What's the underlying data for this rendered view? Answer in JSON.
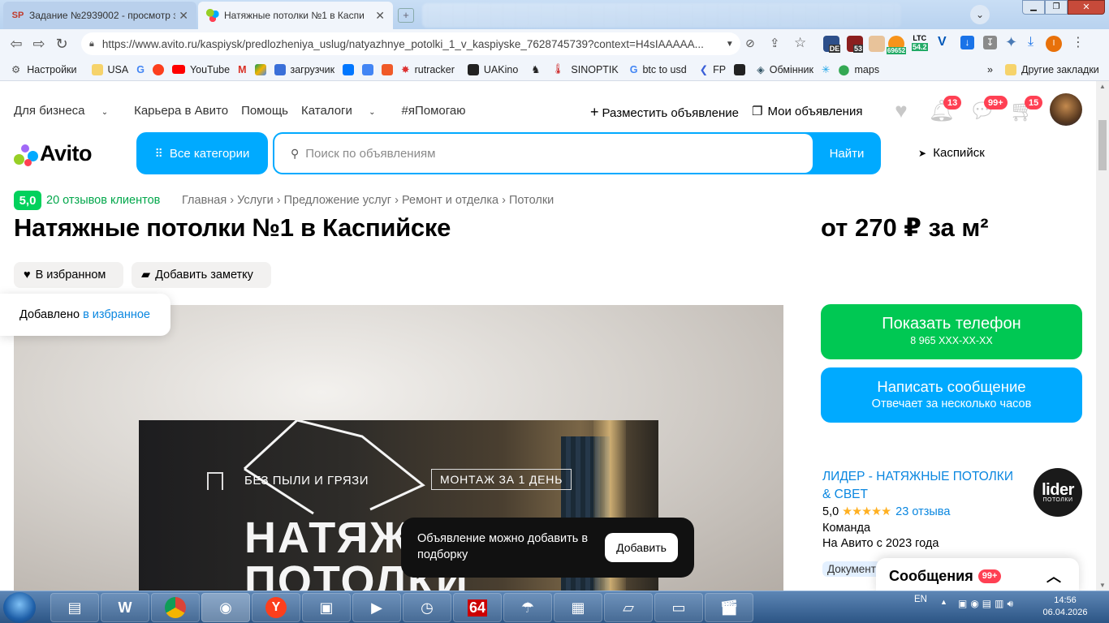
{
  "browser": {
    "tabs": [
      {
        "favicon": "SP",
        "title": "Задание №2939002 - просмотр з",
        "active": false
      },
      {
        "favicon": "",
        "title": "Натяжные потолки №1 в Каспи",
        "active": true
      }
    ],
    "url": "https://www.avito.ru/kaspiysk/predlozheniya_uslug/natyazhnye_potolki_1_v_kaspiyske_7628745739?context=H4sIAAAAA...",
    "extensions": {
      "de": "DE",
      "count53": "53",
      "btc": "69652",
      "ltc_label": "LTC",
      "ltc": "54.2"
    },
    "bookmarks": [
      "Настройки",
      "USA",
      "YouTube",
      "загрузчик",
      "rutracker",
      "UAKino",
      "SINOPTIK",
      "btc to usd",
      "FP",
      "Обмінник",
      "maps"
    ],
    "bookmarks_more": "»",
    "other_bookmarks": "Другие закладки"
  },
  "header": {
    "nav": [
      "Для бизнеса",
      "Карьера в Авито",
      "Помощь",
      "Каталоги",
      "#яПомогаю"
    ],
    "post_ad": "Разместить объявление",
    "my_ads": "Мои объявления",
    "notif_badge": "13",
    "msg_badge": "99+",
    "cart_badge": "15"
  },
  "search": {
    "logo": "Avito",
    "all_categories": "Все категории",
    "placeholder": "Поиск по объявлениям",
    "button": "Найти",
    "city": "Каспийск"
  },
  "listing": {
    "rating": "5,0",
    "reviews_link": "20 отзывов клиентов",
    "breadcrumbs": [
      "Главная",
      "Услуги",
      "Предложение услуг",
      "Ремонт и отделка",
      "Потолки"
    ],
    "title": "Натяжные потолки №1 в Каспийске",
    "price": "от 270 ₽ за м²",
    "favorite_button": "В избранном",
    "note_button": "Добавить заметку",
    "fav_toast_text": "Добавлено",
    "fav_toast_link": "в избранное",
    "banner_text1": "БЕЗ ПЫЛИ И ГРЯЗИ",
    "banner_text2": "МОНТАЖ ЗА 1 ДЕНЬ",
    "banner_big": "НАТЯЖ\nПОТОЛКИ",
    "collection_toast": "Объявление можно добавить в подборку",
    "collection_add": "Добавить"
  },
  "contact": {
    "show_phone": "Показать телефон",
    "phone_masked": "8 965 XXX-XX-XX",
    "write_message": "Написать сообщение",
    "response_time": "Отвечает за несколько часов"
  },
  "seller": {
    "name": "ЛИДЕР - НАТЯЖНЫЕ ПОТОЛКИ & СВЕТ",
    "logo_main": "lider",
    "logo_sub": "ПОТОЛКИ",
    "rating": "5,0",
    "stars": "★★★★★",
    "reviews": "23 отзыва",
    "type": "Команда",
    "since": "На Авито с 2023 года",
    "doc_tag": "Документ"
  },
  "messages_panel": {
    "title": "Сообщения",
    "badge": "99+"
  },
  "taskbar": {
    "lang": "EN",
    "time": "14:56",
    "date": "06.04.2026",
    "app64": "64"
  }
}
